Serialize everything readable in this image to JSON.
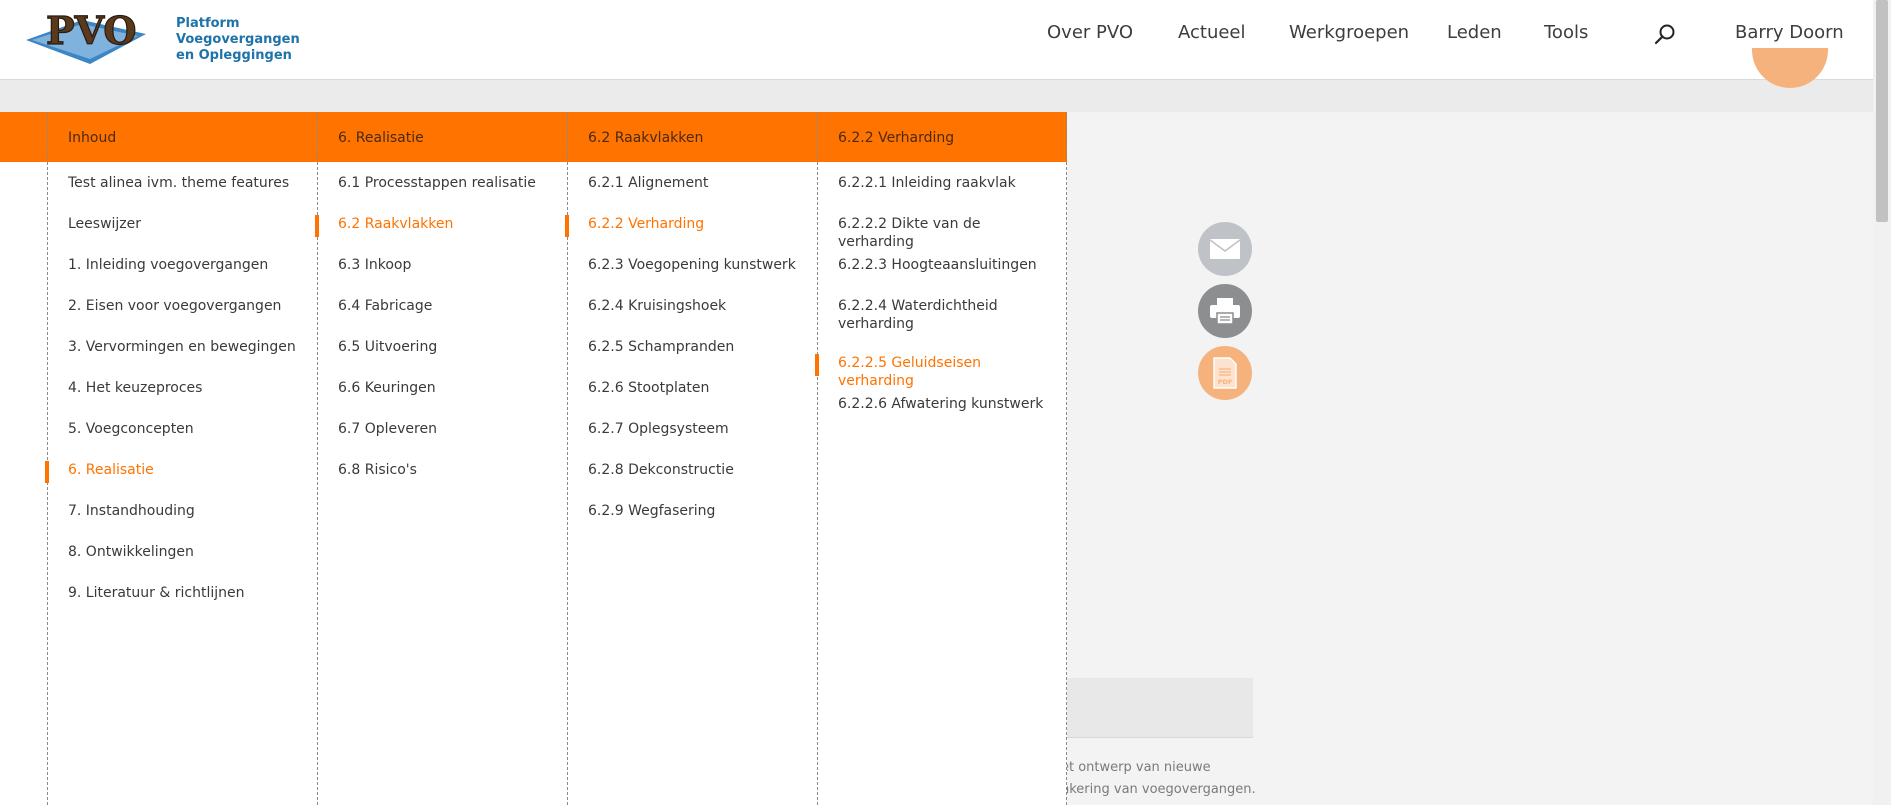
{
  "header": {
    "logo_mark": "PVO",
    "logo_lines": [
      "Platform",
      "Voegovergangen",
      "en Opleggingen"
    ],
    "nav": [
      "Over PVO",
      "Actueel",
      "Werkgroepen",
      "Leden",
      "Tools"
    ],
    "search_icon": "search-icon",
    "user": "Barry Doorn"
  },
  "menu": {
    "columns": [
      {
        "title": "Inhoud",
        "items": [
          {
            "label": "Test alinea ivm. theme features",
            "active": false
          },
          {
            "label": "Leeswijzer",
            "active": false
          },
          {
            "label": "1. Inleiding voegovergangen",
            "active": false
          },
          {
            "label": "2. Eisen voor voegovergangen",
            "active": false
          },
          {
            "label": "3. Vervormingen en bewegingen",
            "active": false
          },
          {
            "label": "4. Het keuzeproces",
            "active": false
          },
          {
            "label": "5. Voegconcepten",
            "active": false
          },
          {
            "label": "6. Realisatie",
            "active": true
          },
          {
            "label": "7. Instandhouding",
            "active": false
          },
          {
            "label": "8. Ontwikkelingen",
            "active": false
          },
          {
            "label": "9. Literatuur & richtlijnen",
            "active": false
          }
        ]
      },
      {
        "title": "6. Realisatie",
        "items": [
          {
            "label": "6.1 Processtappen realisatie",
            "active": false
          },
          {
            "label": "6.2 Raakvlakken",
            "active": true
          },
          {
            "label": "6.3 Inkoop",
            "active": false
          },
          {
            "label": "6.4 Fabricage",
            "active": false
          },
          {
            "label": "6.5 Uitvoering",
            "active": false
          },
          {
            "label": "6.6 Keuringen",
            "active": false
          },
          {
            "label": "6.7 Opleveren",
            "active": false
          },
          {
            "label": "6.8 Risico's",
            "active": false
          }
        ]
      },
      {
        "title": "6.2 Raakvlakken",
        "items": [
          {
            "label": "6.2.1 Alignement",
            "active": false
          },
          {
            "label": "6.2.2 Verharding",
            "active": true
          },
          {
            "label": "6.2.3 Voegopening kunstwerk",
            "active": false
          },
          {
            "label": "6.2.4 Kruisingshoek",
            "active": false
          },
          {
            "label": "6.2.5 Schampranden",
            "active": false
          },
          {
            "label": "6.2.6 Stootplaten",
            "active": false
          },
          {
            "label": "6.2.7 Oplegsysteem",
            "active": false
          },
          {
            "label": "6.2.8 Dekconstructie",
            "active": false
          },
          {
            "label": "6.2.9 Wegfasering",
            "active": false
          }
        ]
      },
      {
        "title": "6.2.2 Verharding",
        "items": [
          {
            "label": "6.2.2.1 Inleiding raakvlak",
            "active": false
          },
          {
            "label": "6.2.2.2 Dikte van de verharding",
            "active": false
          },
          {
            "label": "6.2.2.3 Hoogteaansluitingen",
            "active": false
          },
          {
            "label": "6.2.2.4 Waterdichtheid verharding",
            "active": false,
            "tall": true
          },
          {
            "label": "6.2.2.5 Geluidseisen verharding",
            "active": true
          },
          {
            "label": "6.2.2.6 Afwatering kunstwerk",
            "active": false
          }
        ]
      }
    ]
  },
  "share": {
    "mail_icon": "mail-icon",
    "print_icon": "printer-icon",
    "pdf_icon": "pdf-icon",
    "pdf_label": "PDF"
  },
  "content": {
    "lines": [
      "et ontwerp van nieuwe",
      "nkering van voegovergangen."
    ]
  },
  "colors": {
    "accent": "#ff7300",
    "accent_light": "#f6b27c",
    "logo_blue": "#1e73a8"
  }
}
